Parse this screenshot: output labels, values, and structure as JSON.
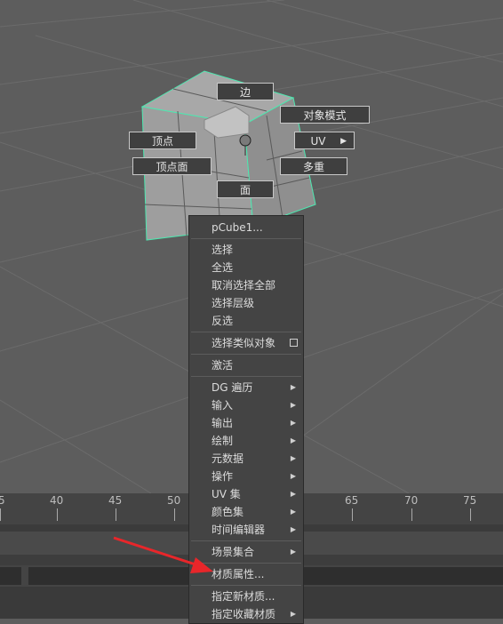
{
  "viewport": {
    "object_name": "pCube1"
  },
  "marking_menu": {
    "edge": "边",
    "object_mode": "对象模式",
    "vertex": "顶点",
    "uv": "UV",
    "vertex_face": "顶点面",
    "multi": "多重",
    "face": "面"
  },
  "context_menu": {
    "title": "pCube1...",
    "items": [
      "选择",
      "全选",
      "取消选择全部",
      "选择层级",
      "反选"
    ],
    "select_similar": "选择类似对象",
    "activate": "激活",
    "submenus": [
      "DG 遍历",
      "输入",
      "输出",
      "绘制",
      "元数据",
      "操作",
      "UV 集",
      "颜色集",
      "时间编辑器"
    ],
    "scene_set": "场景集合",
    "material_attributes": "材质属性...",
    "assign_new_material": "指定新材质...",
    "assign_favorite_material": "指定收藏材质"
  },
  "timeline": {
    "ticks": [
      "5",
      "40",
      "45",
      "50",
      "65",
      "70",
      "75"
    ]
  },
  "colors": {
    "viewport_bg": "#5d5d5d",
    "grid": "#6a6a6a",
    "wireframe_highlight": "#4de8b0",
    "menu_bg": "#444444",
    "annotation_arrow": "#e8262a"
  }
}
